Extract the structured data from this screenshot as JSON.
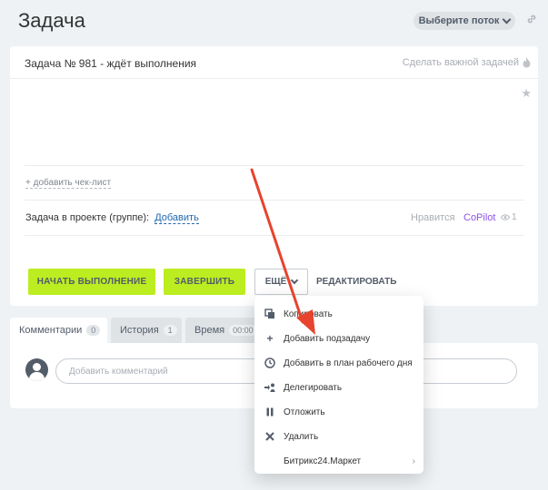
{
  "header": {
    "title": "Задача",
    "stream_select_label": "Выберите поток"
  },
  "task": {
    "title": "Задача № 981 - ждёт выполнения",
    "important_label": "Сделать важной задачей",
    "checklist_link": "+ добавить чек-лист",
    "project_label": "Задача в проекте (группе):",
    "project_add_link": "Добавить",
    "likes_label": "Нравится",
    "copilot_label": "CoPilot",
    "views_count": "1"
  },
  "actions": {
    "start_label": "НАЧАТЬ ВЫПОЛНЕНИЕ",
    "finish_label": "ЗАВЕРШИТЬ",
    "more_label": "ЕЩЁ",
    "edit_label": "РЕДАКТИРОВАТЬ"
  },
  "tabs": [
    {
      "label": "Комментарии",
      "count": "0"
    },
    {
      "label": "История",
      "count": "1"
    },
    {
      "label": "Время",
      "count": "00:00"
    }
  ],
  "comments": {
    "placeholder": "Добавить комментарий"
  },
  "menu": {
    "items": [
      {
        "label": "Копировать",
        "icon": "copy-icon"
      },
      {
        "label": "Добавить подзадачу",
        "icon": "plus-icon"
      },
      {
        "label": "Добавить в план рабочего дня",
        "icon": "clock-icon"
      },
      {
        "label": "Делегировать",
        "icon": "delegate-icon"
      },
      {
        "label": "Отложить",
        "icon": "pause-icon"
      },
      {
        "label": "Удалить",
        "icon": "close-icon"
      },
      {
        "label": "Битрикс24.Маркет",
        "icon": "chevron-right-icon"
      }
    ]
  },
  "colors": {
    "accent_green": "#bbed21",
    "link_blue": "#2067b0",
    "copilot_purple": "#8e52ec",
    "arrow_red": "#e8432e"
  }
}
